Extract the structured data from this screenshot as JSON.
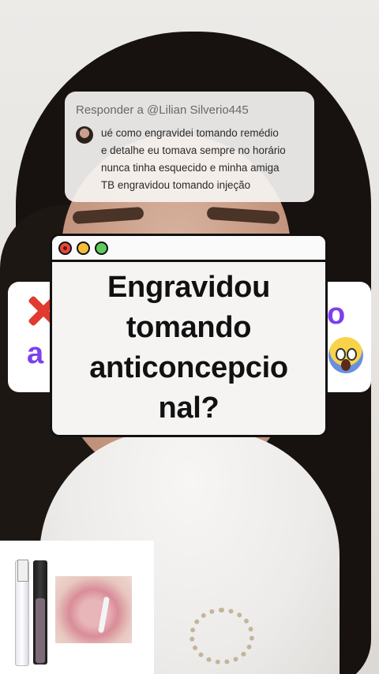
{
  "reply": {
    "header": "Responder a @Lilian Silverio445",
    "lines": [
      "ué como engravidei tomando remédio",
      "e detalhe eu tomava sempre no horário",
      "nunca tinha esquecido e minha amiga",
      "TB engravidou tomando injeção"
    ]
  },
  "side_left": {
    "letter": "a"
  },
  "side_right": {
    "letter": "o"
  },
  "window": {
    "title_lines": [
      "Engravidou",
      "tomando",
      "anticoncepcio",
      "nal?"
    ],
    "dot_colors": {
      "red": "#e8473d",
      "yellow": "#f6bd3b",
      "green": "#5fcb5a"
    }
  },
  "icons": [
    "red-x-icon",
    "scream-emoji-icon",
    "window-close-dot",
    "window-minimize-dot",
    "window-maximize-dot"
  ]
}
